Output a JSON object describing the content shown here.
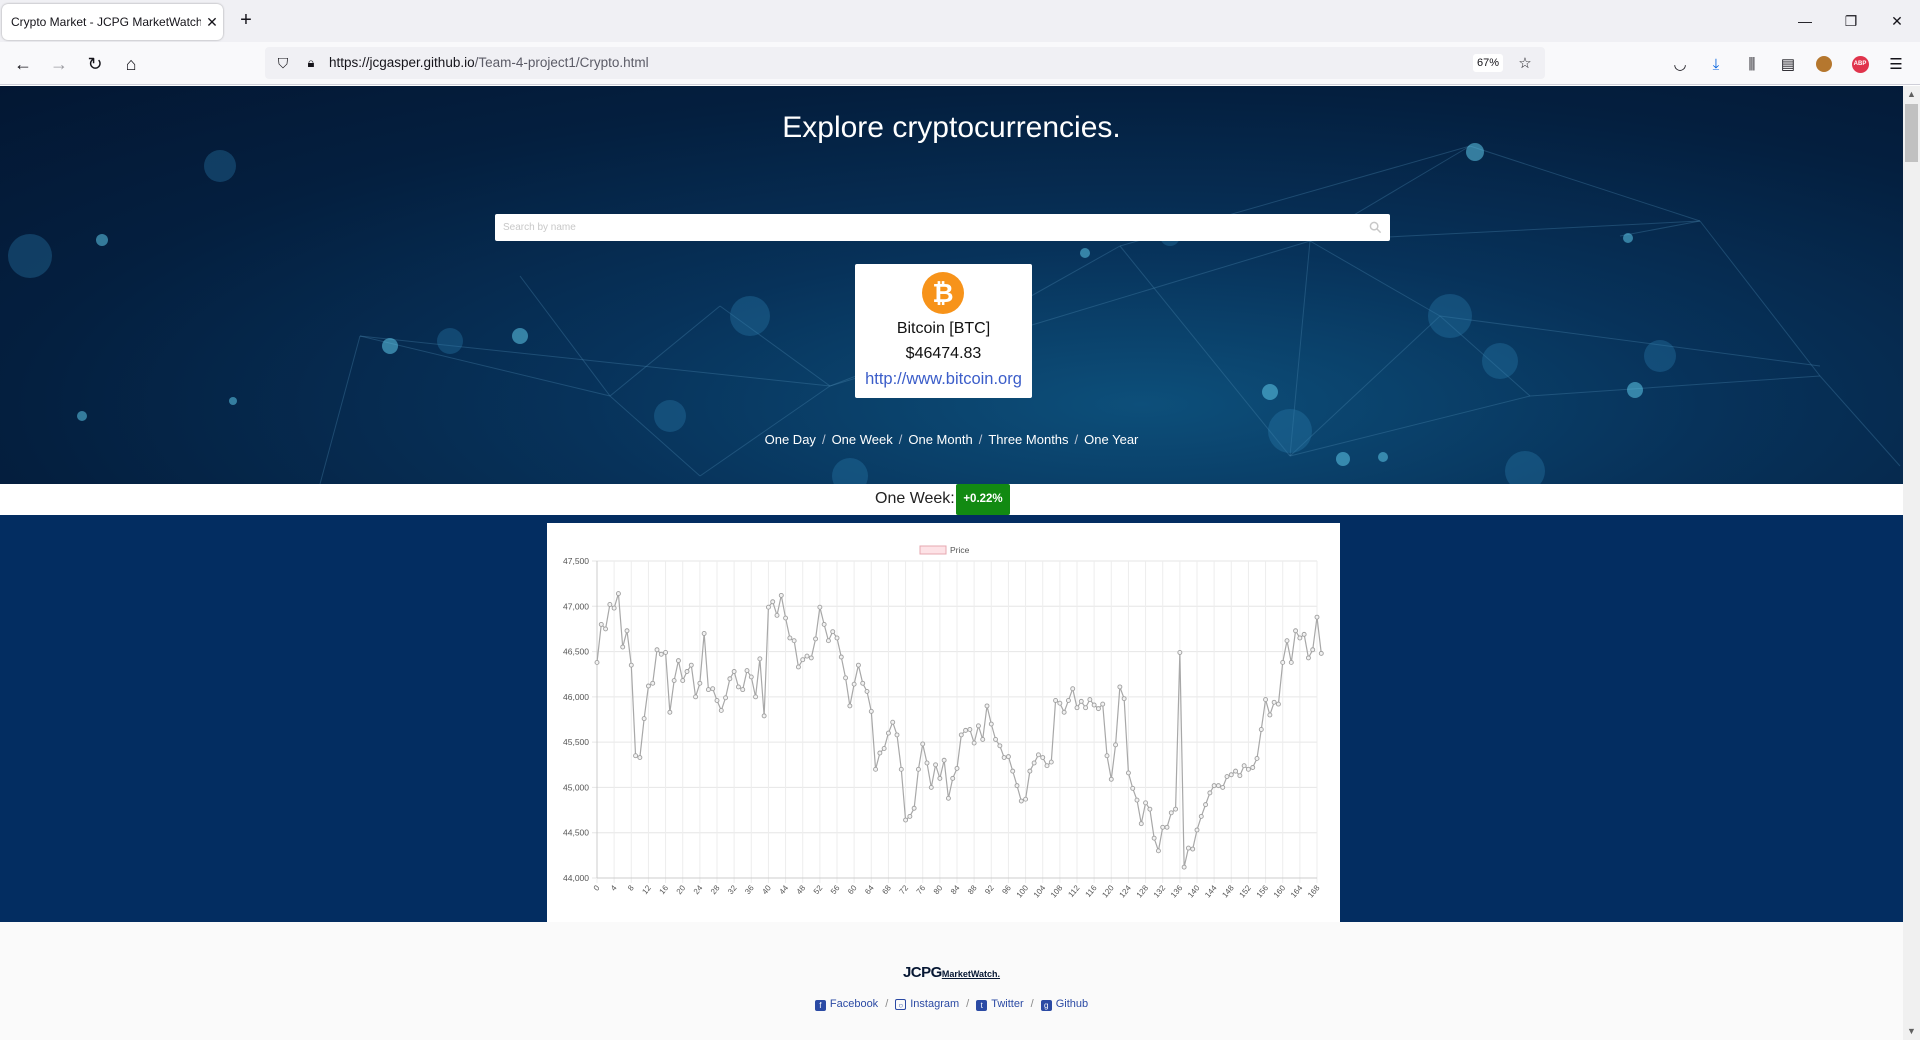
{
  "browser": {
    "tab_title": "Crypto Market - JCPG MarketWatch",
    "url_host": "https://jcgasper.github.io",
    "url_path": "/Team-4-project1/Crypto.html",
    "zoom": "67%"
  },
  "hero": {
    "title": "Explore cryptocurrencies.",
    "search_placeholder": "Search by name"
  },
  "coin": {
    "symbol_glyph": "₿",
    "name": "Bitcoin [BTC]",
    "price": "$46474.83",
    "website": "http://www.bitcoin.org"
  },
  "periods": [
    "One Day",
    "One Week",
    "One Month",
    "Three Months",
    "One Year"
  ],
  "change": {
    "label": "One Week:",
    "value": "+0.22%",
    "color": "#128a12"
  },
  "chart_data": {
    "type": "line",
    "legend": [
      "Price"
    ],
    "ylim": [
      44000,
      47500
    ],
    "yticks": [
      44000,
      44500,
      45000,
      45500,
      46000,
      46500,
      47000,
      47500
    ],
    "ytick_labels": [
      "44,000",
      "44,500",
      "45,000",
      "45,500",
      "46,000",
      "46,500",
      "47,000",
      "47,500"
    ],
    "xlim": [
      0,
      168
    ],
    "xtick_step": 4,
    "series": [
      {
        "name": "Price",
        "color": "#a8a8a8",
        "values": [
          46380,
          46800,
          46750,
          47020,
          46980,
          47140,
          46550,
          46730,
          46350,
          45350,
          45330,
          45760,
          46120,
          46150,
          46520,
          46470,
          46490,
          45830,
          46180,
          46400,
          46180,
          46280,
          46350,
          46000,
          46150,
          46700,
          46080,
          46090,
          45960,
          45850,
          45990,
          46200,
          46280,
          46110,
          46080,
          46290,
          46220,
          46000,
          46420,
          45790,
          46990,
          47050,
          46900,
          47120,
          46870,
          46650,
          46620,
          46330,
          46410,
          46450,
          46430,
          46640,
          46990,
          46800,
          46620,
          46720,
          46650,
          46440,
          46210,
          45900,
          46140,
          46350,
          46150,
          46060,
          45840,
          45200,
          45380,
          45430,
          45600,
          45720,
          45580,
          45200,
          44640,
          44680,
          44770,
          45200,
          45480,
          45270,
          45000,
          45250,
          45100,
          45300,
          44880,
          45100,
          45210,
          45580,
          45630,
          45640,
          45490,
          45680,
          45530,
          45900,
          45700,
          45530,
          45460,
          45330,
          45340,
          45180,
          45020,
          44850,
          44870,
          45180,
          45270,
          45360,
          45330,
          45240,
          45280,
          45960,
          45930,
          45830,
          45960,
          46090,
          45880,
          45950,
          45880,
          45970,
          45910,
          45870,
          45920,
          45350,
          45090,
          45470,
          46110,
          45980,
          45160,
          44990,
          44860,
          44600,
          44830,
          44760,
          44440,
          44300,
          44560,
          44560,
          44720,
          44760,
          46490,
          44120,
          44330,
          44320,
          44530,
          44680,
          44810,
          44940,
          45020,
          45020,
          45000,
          45120,
          45140,
          45180,
          45130,
          45240,
          45200,
          45220,
          45320,
          45640,
          45970,
          45800,
          45940,
          45920,
          46380,
          46620,
          46380,
          46730,
          46650,
          46690,
          46430,
          46520,
          46880,
          46480
        ]
      }
    ]
  },
  "footer": {
    "logo_main": "JCPG",
    "logo_sub": "MarketWatch.",
    "links": [
      "Facebook",
      "Instagram",
      "Twitter",
      "Github"
    ]
  }
}
